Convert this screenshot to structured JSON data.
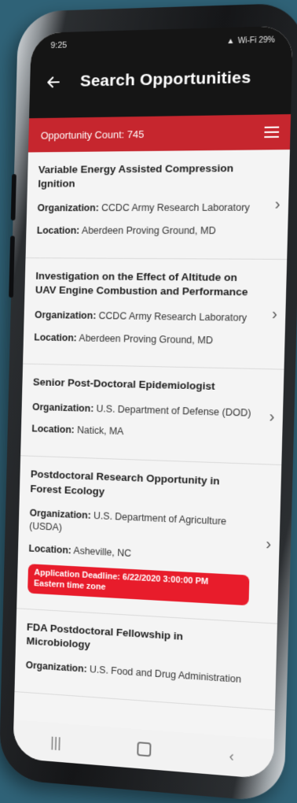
{
  "status": {
    "time": "9:25",
    "right": "Wi-Fi 29%"
  },
  "header": {
    "title": "Search Opportunities"
  },
  "count": {
    "text": "Opportunity Count: 745"
  },
  "opportunities": [
    {
      "title": "Variable Energy Assisted Compression Ignition",
      "org_label": "Organization:",
      "org": "CCDC Army Research Laboratory",
      "loc_label": "Location:",
      "loc": "Aberdeen Proving Ground, MD"
    },
    {
      "title": "Investigation on the Effect of Altitude on UAV Engine Combustion and Performance",
      "org_label": "Organization:",
      "org": "CCDC Army Research Laboratory",
      "loc_label": "Location:",
      "loc": "Aberdeen Proving Ground, MD"
    },
    {
      "title": "Senior Post-Doctoral Epidemiologist",
      "org_label": "Organization:",
      "org": "U.S. Department of Defense (DOD)",
      "loc_label": "Location:",
      "loc": "Natick, MA"
    },
    {
      "title": "Postdoctoral Research Opportunity in Forest Ecology",
      "org_label": "Organization:",
      "org": "U.S. Department of Agriculture (USDA)",
      "loc_label": "Location:",
      "loc": "Asheville, NC",
      "deadline": "Application Deadline: 6/22/2020 3:00:00 PM Eastern time zone"
    },
    {
      "title": "FDA Postdoctoral Fellowship in Microbiology",
      "org_label": "Organization:",
      "org": "U.S. Food and Drug Administration"
    }
  ],
  "nav": {
    "recent": "|||",
    "home": "",
    "back": "‹"
  }
}
